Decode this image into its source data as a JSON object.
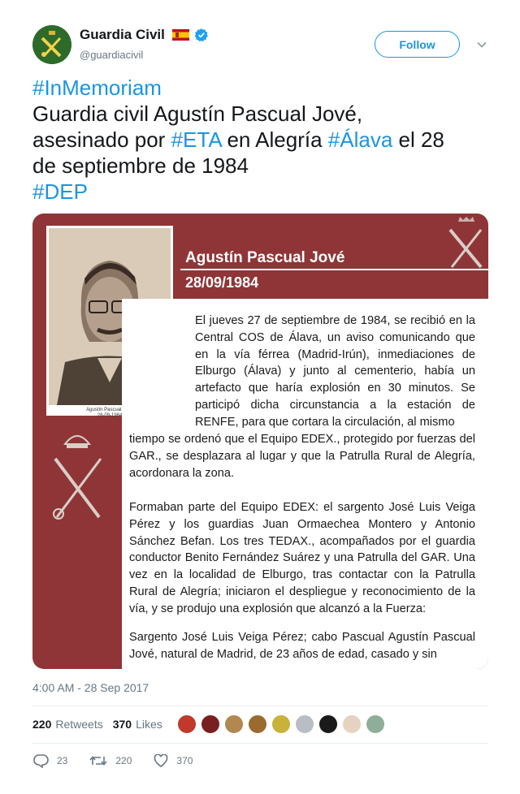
{
  "user": {
    "display_name": "Guardia Civil",
    "handle": "@guardiacivil",
    "follow_label": "Follow"
  },
  "tweet": {
    "hashtag_memoriam": "#InMemoriam",
    "line_a": "Guardia civil Agustín Pascual Jové,",
    "line_b_pre": "asesinado por ",
    "hashtag_eta": "#ETA",
    "line_b_mid": " en Alegría ",
    "hashtag_alava": "#Álava",
    "line_b_post": " el 28",
    "line_c": "de septiembre de 1984",
    "hashtag_dep": "#DEP"
  },
  "media": {
    "title": "Agustín Pascual Jové",
    "date": "28/09/1984",
    "photo_caption_name": "Agustín Pascual Jové",
    "photo_caption_date": "28-09-1984",
    "paragraph_1a": "El jueves 27 de septiembre de 1984, se recibió en la Central COS de Álava, un aviso comunicando que en la vía férrea (Madrid-Irún), inmediaciones de Elburgo (Álava) y junto al cementerio, había un artefacto que haría explosión en 30 minutos. Se participó dicha circunstancia a la estación de RENFE, para que cortara la circulación, al mismo",
    "paragraph_1b": "tiempo se ordenó que el Equipo EDEX., protegido por fuerzas del GAR., se desplazara al lugar y que la Patrulla Rural de Alegría, acordonara la zona.",
    "paragraph_2": "Formaban parte del Equipo EDEX: el sargento José Luis Veiga Pérez y los guardias Juan Ormaechea Montero y Antonio Sánchez Befan. Los tres TEDAX., acompañados por el guardia conductor Benito Fernández Suárez y una Patrulla del GAR. Una vez en la localidad de Elburgo, tras contactar con la Patrulla Rural de Alegría; iniciaron el despliegue y reconocimiento de la vía, y se produjo una explosión que alcanzó a la Fuerza:",
    "paragraph_3": "Sargento José Luis Veiga Pérez; cabo Pascual Agustín Pascual Jové, natural de Madrid, de 23 años de edad, casado y sin"
  },
  "meta": {
    "timestamp": "4:00 AM - 28 Sep 2017",
    "retweets_count": "220",
    "retweets_label": "Retweets",
    "likes_count": "370",
    "likes_label": "Likes"
  },
  "likers": [
    "#c0392b",
    "#7a1f1f",
    "#b08850",
    "#9a6a2e",
    "#c8b23a",
    "#b8bec4",
    "#1a1a1a",
    "#e6d2c0",
    "#8fae9a"
  ],
  "actions": {
    "reply_count": "23",
    "retweet_count": "220",
    "like_count": "370"
  },
  "colors": {
    "accent": "#1b95e0",
    "verified": "#1da1f2",
    "poster_red": "#8f3537",
    "muted_text": "#657786"
  },
  "icons": [
    "avatar-emblem-icon",
    "spain-flag-icon",
    "verified-badge-icon",
    "chevron-down-icon",
    "reply-icon",
    "retweet-icon",
    "heart-icon",
    "crown-emblem-icon",
    "sword-fasces-icon"
  ]
}
